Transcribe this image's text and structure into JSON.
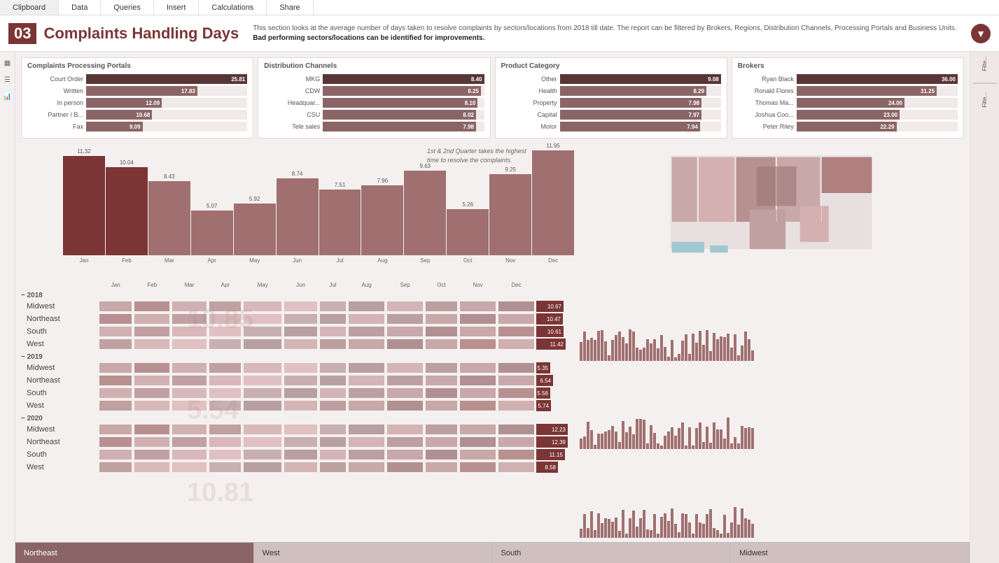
{
  "menu": {
    "items": [
      "Clipboard",
      "Data",
      "Queries",
      "Insert",
      "Calculations",
      "Share"
    ]
  },
  "header": {
    "number": "03",
    "title": "Complaints Handling Days",
    "description": "This section looks at the average number of days taken to resolve complaints by sectors/locations from 2018 till date.  The report can be filtered by Brokers, Regions, Distribution Channels, Processing Portals and Business Units.",
    "description_bold": "Bad performing sectors/locations can be identified for improvements."
  },
  "processing_portals": {
    "title": "Complaints Processing Portals",
    "items": [
      {
        "label": "Court Order",
        "value": 25.81,
        "pct": 100
      },
      {
        "label": "Written",
        "value": 17.83,
        "pct": 69
      },
      {
        "label": "In person",
        "value": 12.09,
        "pct": 47
      },
      {
        "label": "Partner / B...",
        "value": 10.68,
        "pct": 41
      },
      {
        "label": "Fax",
        "value": 9.09,
        "pct": 35
      }
    ]
  },
  "distribution_channels": {
    "title": "Distribution Channels",
    "items": [
      {
        "label": "MKG",
        "value": 8.4,
        "pct": 100
      },
      {
        "label": "CDW",
        "value": 8.25,
        "pct": 98
      },
      {
        "label": "Headquar...",
        "value": 8.1,
        "pct": 96
      },
      {
        "label": "CSU",
        "value": 8.02,
        "pct": 95
      },
      {
        "label": "Tele sales",
        "value": 7.98,
        "pct": 95
      }
    ]
  },
  "product_category": {
    "title": "Product Category",
    "items": [
      {
        "label": "Other",
        "value": 9.08,
        "pct": 100
      },
      {
        "label": "Health",
        "value": 8.29,
        "pct": 91
      },
      {
        "label": "Property",
        "value": 7.98,
        "pct": 88
      },
      {
        "label": "Capital",
        "value": 7.97,
        "pct": 88
      },
      {
        "label": "Motor",
        "value": 7.94,
        "pct": 87
      }
    ]
  },
  "brokers": {
    "title": "Brokers",
    "items": [
      {
        "label": "Ryan Black",
        "value": 36.0,
        "pct": 100
      },
      {
        "label": "Ronald Flores",
        "value": 31.25,
        "pct": 87
      },
      {
        "label": "Thomas Ma...",
        "value": 24.0,
        "pct": 67
      },
      {
        "label": "Joshua Coo...",
        "value": 23.0,
        "pct": 64
      },
      {
        "label": "Peter Riley",
        "value": 22.29,
        "pct": 62
      }
    ]
  },
  "monthly_chart": {
    "annotation": "1st & 2nd Quarter takes the highest\ntime to resolve the complaints.",
    "months": [
      "Jan",
      "Feb",
      "Mar",
      "Apr",
      "May",
      "Jun",
      "Jul",
      "Aug",
      "Sep",
      "Oct",
      "Nov",
      "Dec"
    ],
    "values": [
      11.32,
      10.04,
      8.43,
      5.07,
      5.92,
      8.74,
      7.51,
      7.96,
      9.63,
      5.26,
      9.25,
      11.95
    ],
    "highlight": [
      0,
      1
    ]
  },
  "heatmap": {
    "years": [
      {
        "year": "2018",
        "regions": [
          "Midwest",
          "Northeast",
          "South",
          "West"
        ],
        "values": [
          10.67,
          10.47,
          10.61,
          11.42
        ],
        "watermark": "10.85"
      },
      {
        "year": "2019",
        "regions": [
          "Midwest",
          "Northeast",
          "South",
          "West"
        ],
        "values": [
          5.35,
          6.54,
          5.56,
          5.74
        ],
        "watermark": "5.54"
      },
      {
        "year": "2020",
        "regions": [
          "Midwest",
          "Northeast",
          "South",
          "West"
        ],
        "values": [
          12.23,
          12.39,
          11.15,
          8.58
        ],
        "watermark": "10.81"
      }
    ]
  },
  "bottom_bar": {
    "regions": [
      "Northeast",
      "West",
      "South",
      "Midwest"
    ],
    "active": "Northeast"
  }
}
